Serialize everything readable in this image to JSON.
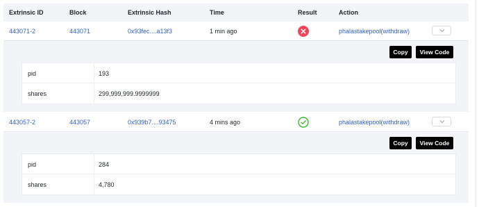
{
  "columns": {
    "extrinsic_id": "Extrinsic ID",
    "block": "Block",
    "extrinsic_hash": "Extrinsic Hash",
    "time": "Time",
    "result": "Result",
    "action": "Action"
  },
  "rows": [
    {
      "extrinsic_id": "443071-2",
      "block": "443071",
      "hash": "0x93fec....a13f3",
      "time": "1 min ago",
      "result": "failed",
      "result_icon": "x-circle-icon",
      "action": "phalastakepool(withdraw)",
      "copy_label": "Copy",
      "view_code_label": "View Code",
      "params": [
        {
          "key": "pid",
          "value": "193"
        },
        {
          "key": "shares",
          "value": "299,999,999.9999999"
        }
      ]
    },
    {
      "extrinsic_id": "443057-2",
      "block": "443057",
      "hash": "0x939b7....93475",
      "time": "4 mins ago",
      "result": "success",
      "result_icon": "check-circle-icon",
      "action": "phalastakepool(withdraw)",
      "copy_label": "Copy",
      "view_code_label": "View Code",
      "params": [
        {
          "key": "pid",
          "value": "284"
        },
        {
          "key": "shares",
          "value": "4,780"
        }
      ]
    }
  ],
  "colors": {
    "link": "#2f5fd0",
    "fail": "#f0455b",
    "success": "#3cb832",
    "header_bg": "#f3f4f8",
    "button_bg": "#000000"
  }
}
